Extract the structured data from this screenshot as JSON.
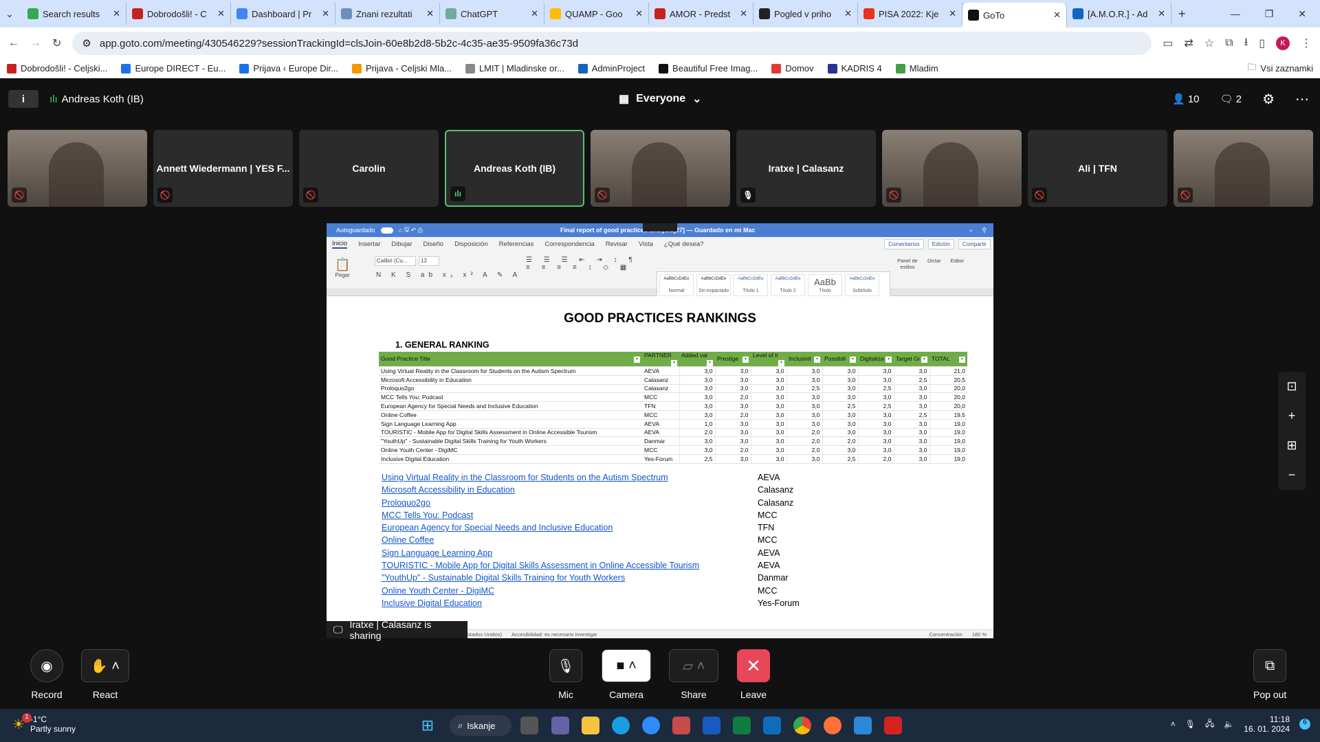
{
  "browser": {
    "tabs": [
      {
        "title": "Search results",
        "color": "#34a853"
      },
      {
        "title": "Dobrodošli! - C",
        "color": "#c5221f"
      },
      {
        "title": "Dashboard | Pr",
        "color": "#4285f4"
      },
      {
        "title": "Znani rezultati",
        "color": "#6c8ebf"
      },
      {
        "title": "ChatGPT",
        "color": "#74aa9c"
      },
      {
        "title": "QUAMP - Goo",
        "color": "#fbbc04"
      },
      {
        "title": "AMOR - Predst",
        "color": "#c5221f"
      },
      {
        "title": "Pogled v priho",
        "color": "#222222"
      },
      {
        "title": "PISA 2022: Kje",
        "color": "#e8331c"
      },
      {
        "title": "GoTo",
        "color": "#111111"
      },
      {
        "title": "[A.M.O.R.] - Ad",
        "color": "#1565c0"
      }
    ],
    "active_tab": 9,
    "url": "app.goto.com/meeting/430546229?sessionTrackingId=clsJoin-60e8b2d8-5b2c-4c35-ae35-9509fa36c73d",
    "profile_initial": "K",
    "bookmarks": [
      {
        "label": "Dobrodošli! - Celjski...",
        "color": "#c5221f"
      },
      {
        "label": "Europe DIRECT - Eu...",
        "color": "#1a73e8"
      },
      {
        "label": "Prijava ‹ Europe Dir...",
        "color": "#1a73e8"
      },
      {
        "label": "Prijava - Celjski Mla...",
        "color": "#f29900"
      },
      {
        "label": "LMIT | Mladinske or...",
        "color": "#888888"
      },
      {
        "label": "AdminProject",
        "color": "#1565c0"
      },
      {
        "label": "Beautiful Free Imag...",
        "color": "#111111"
      },
      {
        "label": "Domov",
        "color": "#e53935"
      },
      {
        "label": "KADRIS 4",
        "color": "#283593"
      },
      {
        "label": "Mladim",
        "color": "#43a047"
      }
    ],
    "all_bookmarks": "Vsi zaznamki"
  },
  "meeting": {
    "speaker": "Andreas Koth (IB)",
    "view": "Everyone",
    "participants": "10",
    "chat_count": "2",
    "tiles": [
      {
        "name": "",
        "video": true,
        "mic": "muted"
      },
      {
        "name": "Annett Wiedermann | YES F...",
        "video": false,
        "mic": "muted"
      },
      {
        "name": "Carolin",
        "video": false,
        "mic": "muted"
      },
      {
        "name": "Andreas Koth (IB)",
        "video": false,
        "mic": "speaking"
      },
      {
        "name": "",
        "video": true,
        "mic": "muted"
      },
      {
        "name": "Iratxe | Calasanz",
        "video": false,
        "mic": "on"
      },
      {
        "name": "",
        "video": true,
        "mic": "muted"
      },
      {
        "name": "Ali | TFN",
        "video": false,
        "mic": "muted"
      },
      {
        "name": "",
        "video": true,
        "mic": "muted"
      }
    ],
    "sharing_label": "Iratxe | Calasanz is sharing",
    "controls": {
      "record": "Record",
      "react": "React",
      "mic": "Mic",
      "camera": "Camera",
      "share": "Share",
      "leave": "Leave",
      "popout": "Pop out"
    },
    "leave_color": "#e8475a"
  },
  "word": {
    "autosave": "Autoguardado",
    "doc_title": "Final report of good practices analysis[27] — Guardado en mi Mac",
    "ribbon_tabs": [
      "Inicio",
      "Insertar",
      "Dibujar",
      "Diseño",
      "Disposición",
      "Referencias",
      "Correspondencia",
      "Revisar",
      "Vista",
      "¿Qué desea?"
    ],
    "right_buttons": [
      "Comentarios",
      "Edición",
      "Compartir"
    ],
    "font": "Calibri (Cu...",
    "size": "12",
    "paste": "Pegar",
    "styles": [
      "Normal",
      "Sin espaciado",
      "Título 1",
      "Título 2",
      "Título",
      "Subtítulo"
    ],
    "style_panel": "Panel de estilos",
    "dictate": "Dictar",
    "editor": "Editor",
    "status": [
      "stados Unidos)",
      "Accesibilidad: es necesario investigar",
      "Concentración",
      "180 %"
    ],
    "heading": "GOOD PRACTICES RANKINGS",
    "section": "1.   GENERAL RANKING",
    "table": {
      "headers": [
        "Good Practice Title",
        "PARTNER",
        "Added val",
        "Prestige",
        "Level of Ir",
        "Inclusivit",
        "Possibili",
        "Digitaliza",
        "Target Gr",
        "TOTAL"
      ],
      "rows": [
        [
          "Using Virtual Reality in the Classroom for Students on the Autism Spectrum",
          "AEVA",
          "3,0",
          "3,0",
          "3,0",
          "3,0",
          "3,0",
          "3,0",
          "3,0",
          "21,0"
        ],
        [
          "Microsoft Accessibility in Education",
          "Calasanz",
          "3,0",
          "3,0",
          "3,0",
          "3,0",
          "3,0",
          "3,0",
          "2,5",
          "20,5"
        ],
        [
          "Proloquo2go",
          "Calasanz",
          "3,0",
          "3,0",
          "3,0",
          "2,5",
          "3,0",
          "2,5",
          "3,0",
          "20,0"
        ],
        [
          "MCC Tells You: Podcast",
          "MCC",
          "3,0",
          "2,0",
          "3,0",
          "3,0",
          "3,0",
          "3,0",
          "3,0",
          "20,0"
        ],
        [
          "European Agency for Special Needs and Inclusive Education",
          "TFN",
          "3,0",
          "3,0",
          "3,0",
          "3,0",
          "2,5",
          "2,5",
          "3,0",
          "20,0"
        ],
        [
          "Online Coffee",
          "MCC",
          "3,0",
          "2,0",
          "3,0",
          "3,0",
          "3,0",
          "3,0",
          "2,5",
          "19,5"
        ],
        [
          "Sign Language Learning App",
          "AEVA",
          "1,0",
          "3,0",
          "3,0",
          "3,0",
          "3,0",
          "3,0",
          "3,0",
          "19,0"
        ],
        [
          "TOURISTIC - Mobile App for Digital Skills Assessment in Online Accessible Tourism",
          "AEVA",
          "2,0",
          "3,0",
          "3,0",
          "2,0",
          "3,0",
          "3,0",
          "3,0",
          "19,0"
        ],
        [
          "\"YouthUp\" - Sustainable Digital Skills Training for Youth Workers",
          "Danmar",
          "3,0",
          "3,0",
          "3,0",
          "2,0",
          "2,0",
          "3,0",
          "3,0",
          "19,0"
        ],
        [
          "Online Youth Center - DigiMC",
          "MCC",
          "3,0",
          "2,0",
          "3,0",
          "2,0",
          "3,0",
          "3,0",
          "3,0",
          "19,0"
        ],
        [
          "Inclusive Digital Education",
          "Yes-Forum",
          "2,5",
          "3,0",
          "3,0",
          "3,0",
          "2,5",
          "2,0",
          "3,0",
          "19,0"
        ]
      ],
      "header_color": "#70ad47"
    },
    "links": [
      {
        "text": "Using Virtual Reality in the Classroom for Students on the Autism Spectrum",
        "partner": "AEVA"
      },
      {
        "text": "Microsoft Accessibility in Education",
        "partner": "Calasanz"
      },
      {
        "text": "Proloquo2go",
        "partner": "Calasanz"
      },
      {
        "text": "MCC Tells You: Podcast",
        "partner": "MCC"
      },
      {
        "text": "European Agency for Special Needs and Inclusive Education",
        "partner": "TFN"
      },
      {
        "text": "Online Coffee",
        "partner": "MCC"
      },
      {
        "text": "Sign Language Learning App",
        "partner": "AEVA"
      },
      {
        "text": "TOURISTIC - Mobile App for Digital Skills Assessment in Online Accessible Tourism",
        "partner": "AEVA"
      },
      {
        "text": "\"YouthUp\" - Sustainable Digital Skills Training for Youth Workers",
        "partner": "Danmar"
      },
      {
        "text": "Online Youth Center - DigiMC",
        "partner": "MCC"
      },
      {
        "text": "Inclusive Digital Education",
        "partner": "Yes-Forum"
      }
    ]
  },
  "taskbar": {
    "weather_temp": "-1°C",
    "weather_desc": "Partly sunny",
    "weather_badge": "1",
    "search": "Iskanje",
    "time": "11:18",
    "date": "16. 01. 2024",
    "notif": "6"
  }
}
